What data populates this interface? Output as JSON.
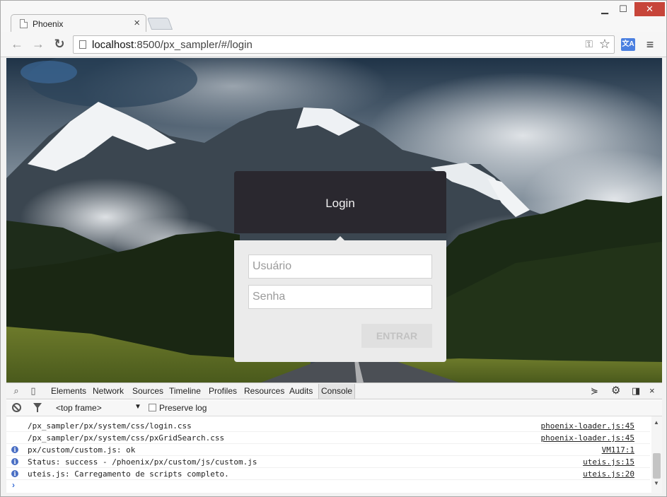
{
  "browser": {
    "tab_title": "Phoenix",
    "url_host": "localhost",
    "url_rest": ":8500/px_sampler/#/login"
  },
  "login": {
    "title": "Login",
    "username_placeholder": "Usuário",
    "password_placeholder": "Senha",
    "submit_label": "ENTRAR",
    "header_color": "#2a282f",
    "body_color": "#ebebeb"
  },
  "devtools": {
    "tabs": [
      "Elements",
      "Network",
      "Sources",
      "Timeline",
      "Profiles",
      "Resources",
      "Audits",
      "Console"
    ],
    "active_tab": "Console",
    "frame": "<top frame>",
    "preserve_log": "Preserve log",
    "logs": [
      {
        "text": "/px_sampler/px/system/css/login.css",
        "source": "phoenix-loader.js:45",
        "level": "log"
      },
      {
        "text": "/px_sampler/px/system/css/pxGridSearch.css",
        "source": "phoenix-loader.js:45",
        "level": "log"
      },
      {
        "text": "px/custom/custom.js: ok",
        "source": "VM117:1",
        "level": "info"
      },
      {
        "text": "Status: success - /phoenix/px/custom/js/custom.js",
        "source": "uteis.js:15",
        "level": "info"
      },
      {
        "text": "uteis.js: Carregamento de scripts completo.",
        "source": "uteis.js:20",
        "level": "info"
      }
    ]
  },
  "icons": {
    "nav_back": "arrow-left",
    "nav_forward": "arrow-right",
    "reload": "reload",
    "bookmark": "star",
    "translate": "translate",
    "menu": "hamburger"
  }
}
